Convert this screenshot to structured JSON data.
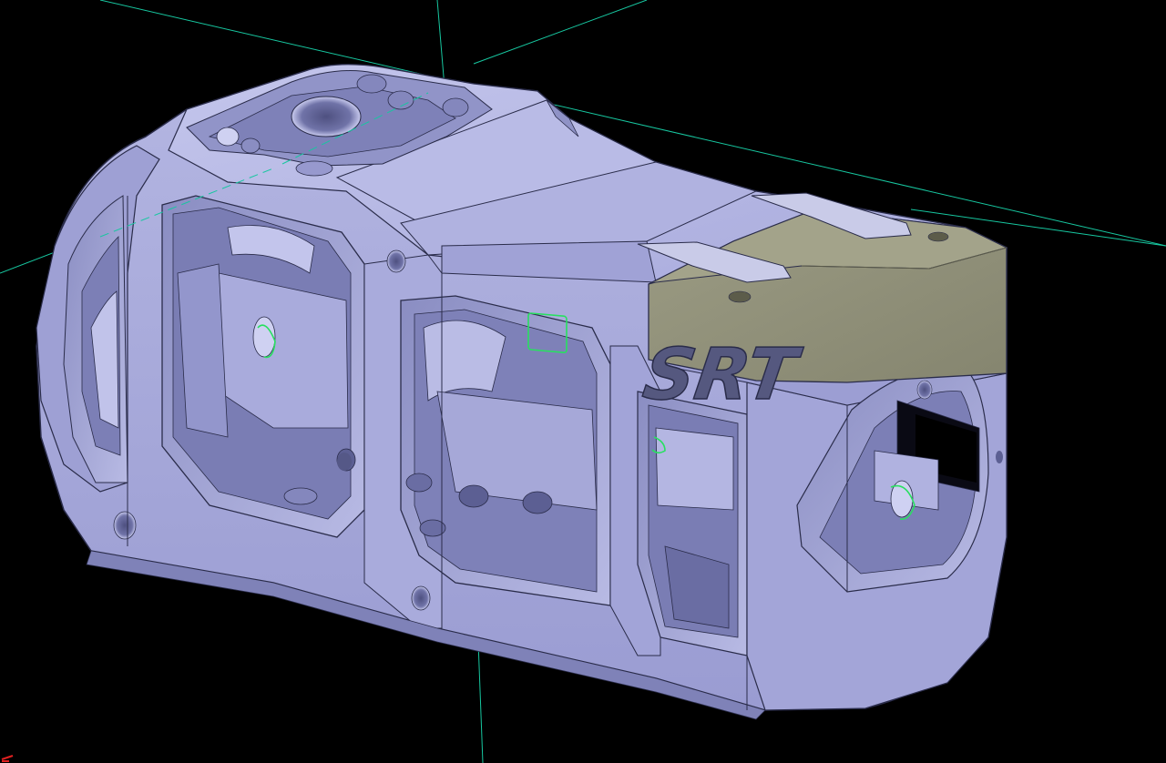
{
  "viewport": {
    "background": "#000000",
    "model_color": "#a6a8d8",
    "model_shadow": "#7f82b8",
    "model_dark": "#5c5f93",
    "model_highlight": "#cfd1f2",
    "edge_color": "#2a2c4a",
    "cap_color": "#8e8e78",
    "cap_highlight": "#a3a38a",
    "axis_color": "#17c7a0",
    "selection_color": "#28e060"
  },
  "part": {
    "engraving_text": "SRT"
  },
  "icons": {
    "compass": "axis-triad-icon"
  }
}
